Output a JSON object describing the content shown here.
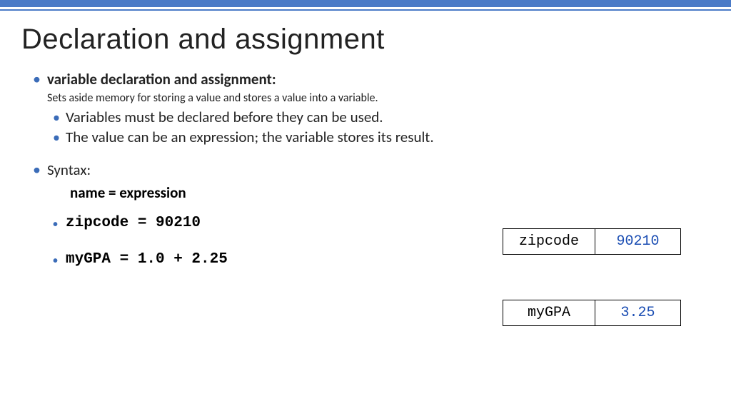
{
  "title": "Declaration and assignment",
  "main_bullet": "variable declaration and assignment",
  "desc": "Sets aside memory for storing a value and stores a value into a variable.",
  "sub1": "Variables must be declared before they can be used.",
  "sub2": "The value can be an expression; the variable stores its result.",
  "syntax_label": "Syntax:",
  "syntax_line": "name  =  expression",
  "code1": "zipcode = 90210",
  "code2": "myGPA = 1.0 + 2.25",
  "box1": {
    "name": "zipcode",
    "value": "90210"
  },
  "box2": {
    "name": "myGPA",
    "value": "3.25"
  }
}
